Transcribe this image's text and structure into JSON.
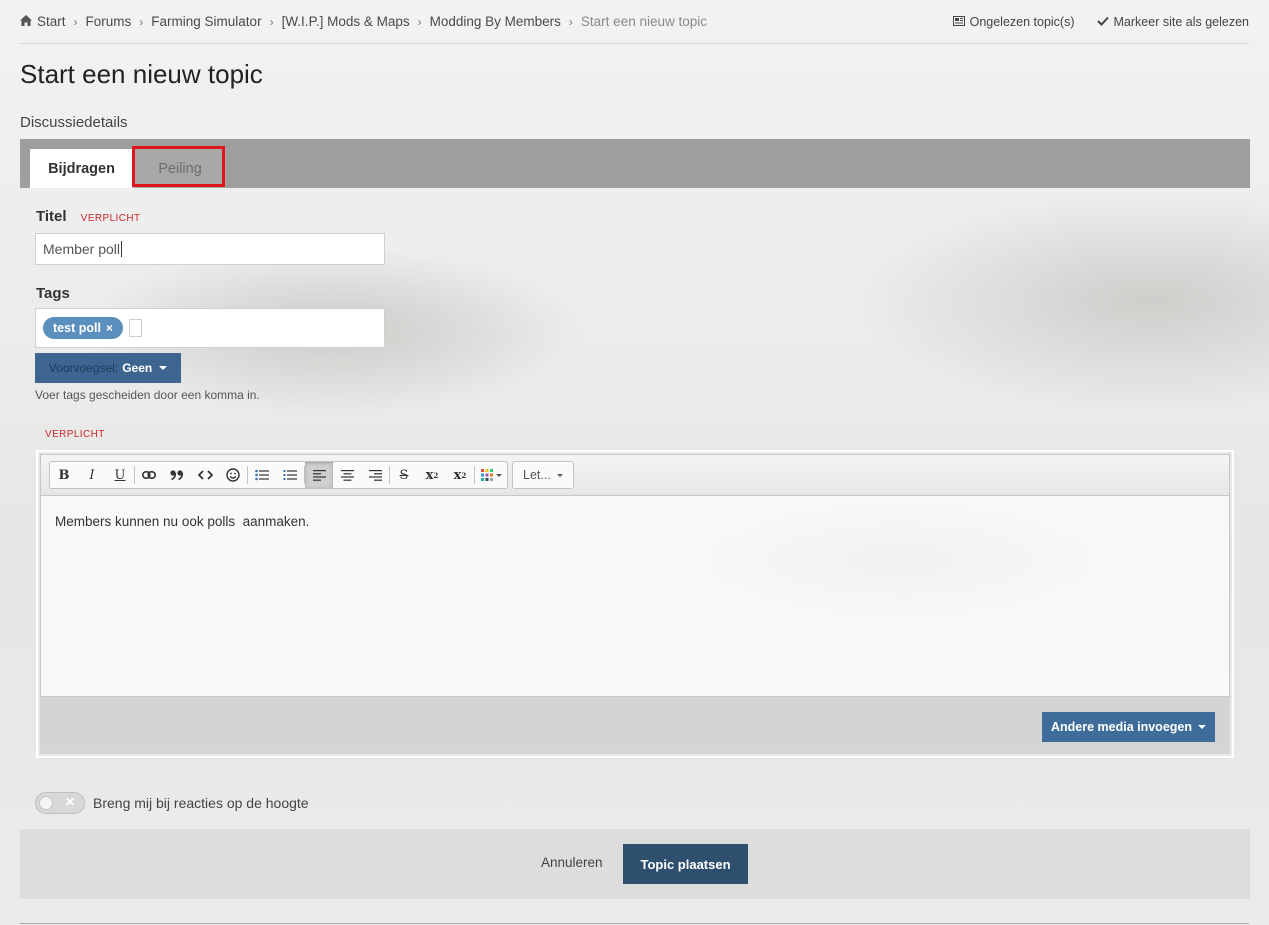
{
  "breadcrumb": {
    "items": [
      "Start",
      "Forums",
      "Farming Simulator",
      "[W.I.P.] Mods & Maps",
      "Modding By Members"
    ],
    "current": "Start een nieuw topic"
  },
  "top_actions": {
    "unread": "Ongelezen topic(s)",
    "mark_read": "Markeer site als gelezen"
  },
  "page": {
    "title": "Start een nieuw topic",
    "section": "Discussiedetails"
  },
  "tabs": [
    {
      "label": "Bijdragen",
      "active": true
    },
    {
      "label": "Peiling",
      "active": false,
      "highlighted": true
    }
  ],
  "form": {
    "title_label": "Titel",
    "required": "VERPLICHT",
    "title_value": "Member poll",
    "tags_label": "Tags",
    "tags": [
      "test poll"
    ],
    "tag_remove": "×",
    "prefix_label": "Voorvoegsel:",
    "prefix_value": "Geen",
    "tags_hint": "Voer tags gescheiden door een komma in.",
    "editor_required": "VERPLICHT",
    "editor_content": "Members kunnen nu ook polls  aanmaken.",
    "font_select": "Let...",
    "media_button": "Andere media invoegen",
    "follow_label": "Breng mij bij reacties op de hoogte",
    "follow_enabled": false
  },
  "toolbar_icons": [
    "bold-icon",
    "italic-icon",
    "underline-icon",
    "link-icon",
    "quote-icon",
    "code-icon",
    "emoji-icon",
    "bulleted-list-icon",
    "numbered-list-icon",
    "align-left-icon",
    "align-center-icon",
    "align-right-icon",
    "strikethrough-icon",
    "superscript-icon",
    "subscript-icon",
    "color-icon"
  ],
  "actions": {
    "cancel": "Annuleren",
    "submit": "Topic plaatsen"
  },
  "colors": {
    "highlight_border": "#e0161e",
    "primary_button": "#2f4f6f",
    "tag_chip": "#5b8fbe",
    "required_text": "#c8262c"
  }
}
